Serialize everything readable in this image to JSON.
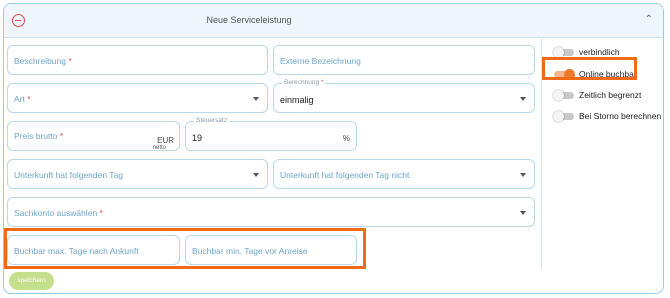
{
  "header": {
    "title": "Neue Serviceleistung"
  },
  "fields": {
    "beschreibung": {
      "placeholder": "Beschreibung",
      "required": "*"
    },
    "externe": {
      "placeholder": "Externe Bezeichnung"
    },
    "art": {
      "placeholder": "Art",
      "required": "*"
    },
    "berechnung": {
      "label": "Berechnung",
      "required": "*",
      "value": "einmalig"
    },
    "preis": {
      "placeholder": "Preis brutto",
      "required": "*",
      "unit": "EUR",
      "subunit": "netto"
    },
    "steuersatz": {
      "label": "Steuersatz",
      "value": "19",
      "unit": "%"
    },
    "tag": {
      "placeholder": "Unterkunft hat folgenden Tag"
    },
    "tag_nicht": {
      "placeholder": "Unterkunft hat folgenden Tag nicht"
    },
    "sachkonto": {
      "placeholder": "Sachkonto auswählen",
      "required": "*"
    },
    "max_tage": {
      "placeholder": "Buchbar max. Tage nach Ankunft"
    },
    "min_tage": {
      "placeholder": "Buchbar min. Tage vor Anreise"
    }
  },
  "toggles": [
    {
      "label": "verbindlich",
      "on": false
    },
    {
      "label": "Online buchbar",
      "on": true
    },
    {
      "label": "Zeitlich begrenzt",
      "on": false
    },
    {
      "label": "Bei Storno berechnen",
      "on": false
    }
  ],
  "save_label": "speichern",
  "colors": {
    "accent": "#f07a2b",
    "highlight": "#f06a1a",
    "border": "#b9d9ec",
    "save": "#c5e08c"
  }
}
